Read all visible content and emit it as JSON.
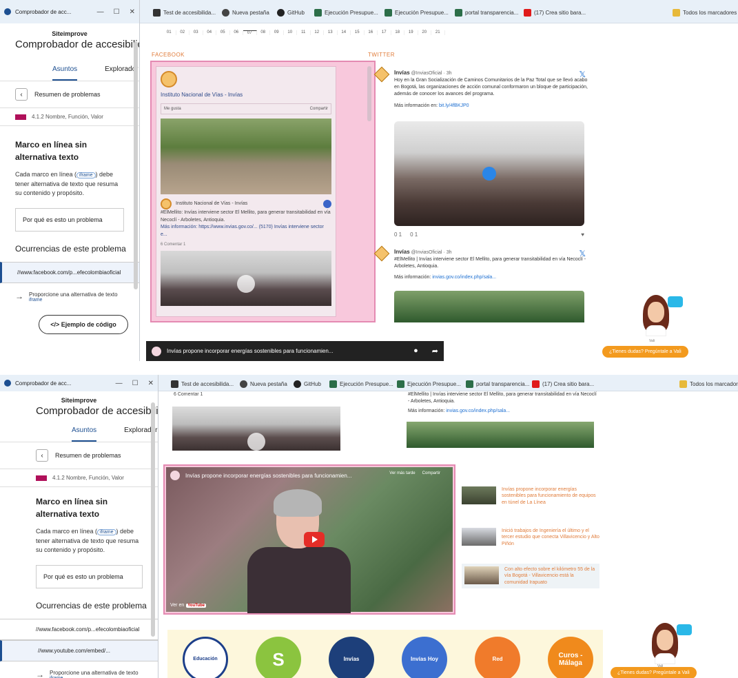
{
  "browser": {
    "window_title": "Comprobador de acc...",
    "bookmarks": [
      "Test de accesibilida...",
      "Nueva pestaña",
      "GitHub",
      "Ejecución Presupue...",
      "Ejecución Presupue...",
      "portal transparencia...",
      "(17) Crea sitio bara...",
      "Todos los marcadores"
    ]
  },
  "siteimprove": {
    "brand": "Siteimprove",
    "title": "Comprobador de accesibilidad",
    "tabs": [
      "Asuntos",
      "Explorador"
    ],
    "back_label": "Resumen de problemas",
    "criterion": "4.1.2 Nombre, Función, Valor",
    "issue_title": "Marco en línea sin alternativa texto",
    "issue_body_a": "Cada marco en línea (",
    "issue_code": "iframe",
    "issue_body_b": ") debe tener alternativa de texto que resuma su contenido y propósito.",
    "why_button": "Por qué es esto un problema",
    "occurrences_heading": "Ocurrencias de este problema",
    "occurrence_urls": [
      "//www.facebook.com/p...efecolombiaoficial",
      "//www.youtube.com/embed/..."
    ],
    "proposal_text": "Proporcione una alternativa de texto",
    "proposal_sub": "iframe",
    "code_button": "</> Ejemplo de código"
  },
  "page": {
    "days": [
      "01",
      "02",
      "03",
      "04",
      "05",
      "06",
      "07",
      "08",
      "09",
      "10",
      "11",
      "12",
      "13",
      "14",
      "15",
      "16",
      "17",
      "18",
      "19",
      "20",
      "21"
    ],
    "facebook_label": "FACEBOOK",
    "twitter_label": "TWITTER",
    "facebook": {
      "page_name": "Instituto Nacional de Vías - Invías",
      "btn_left": "Me gusta",
      "btn_right": "Compartir",
      "post_author": "Instituto Nacional de Vías - Invías",
      "post_text": "#ElMellito: Invías interviene sector El Mellito, para generar transitabilidad en vía Necoclí - Arboletes, Antioquia.",
      "post_link": "Más información: https://www.invias.gov.co/... (5170) Invías interviene sector e...",
      "reactions": "6  Comentar  1"
    },
    "tweets": [
      {
        "user": "Invías",
        "handle": "@InviasOficial · 3h",
        "text": "Hoy en la Gran Socialización de Caminos Comunitarios de la Paz Total que se llevó acabo en Bogotá, las organizaciones de acción comunal conformaron un bloque de participación, además de conocer los avances del programa.",
        "more": "Más información en:",
        "link": "bit.ly/4fBKJP0",
        "stats": [
          "0  1",
          "0  1",
          "♥"
        ]
      },
      {
        "user": "Invías",
        "handle": "@InviasOficial · 3h",
        "text": "#ElMellito | Invías interviene sector El Mellito, para generar transitabilidad en vía Necoclí - Arboletes, Antioquia.",
        "more": "Más información:",
        "link": "invias.gov.co/index.php/sala..."
      }
    ],
    "yt_title": "Invías propone incorporar energías sostenibles para funcionamien...",
    "assistant_button": "¿Tienes dudas? Pregúntale a Vali",
    "assistant_name": "Vali",
    "big_video": {
      "title": "Invías propone incorporar energías sostenibles para funcionamien...",
      "tool1": "Ver más tarde",
      "tool2": "Compartir",
      "watch": "Ver en",
      "yt": "YouTube"
    },
    "video_list": [
      "Invías propone incorporar energías sostenibles para funcionamiento de equipos en túnel de La Línea",
      "Inició trabajos de Ingeniería el último y el tercer estudio que conecta Villavicencio y Alto Piñón",
      "Con alto efecto sobre el kilómetro 55 de la vía Bogotá - Villavicencio está la comunidad Irapuato"
    ],
    "footer_logos": [
      "Educación",
      "S",
      "Invías",
      "Invías Hoy",
      "Red",
      "Curos - Málaga"
    ]
  }
}
